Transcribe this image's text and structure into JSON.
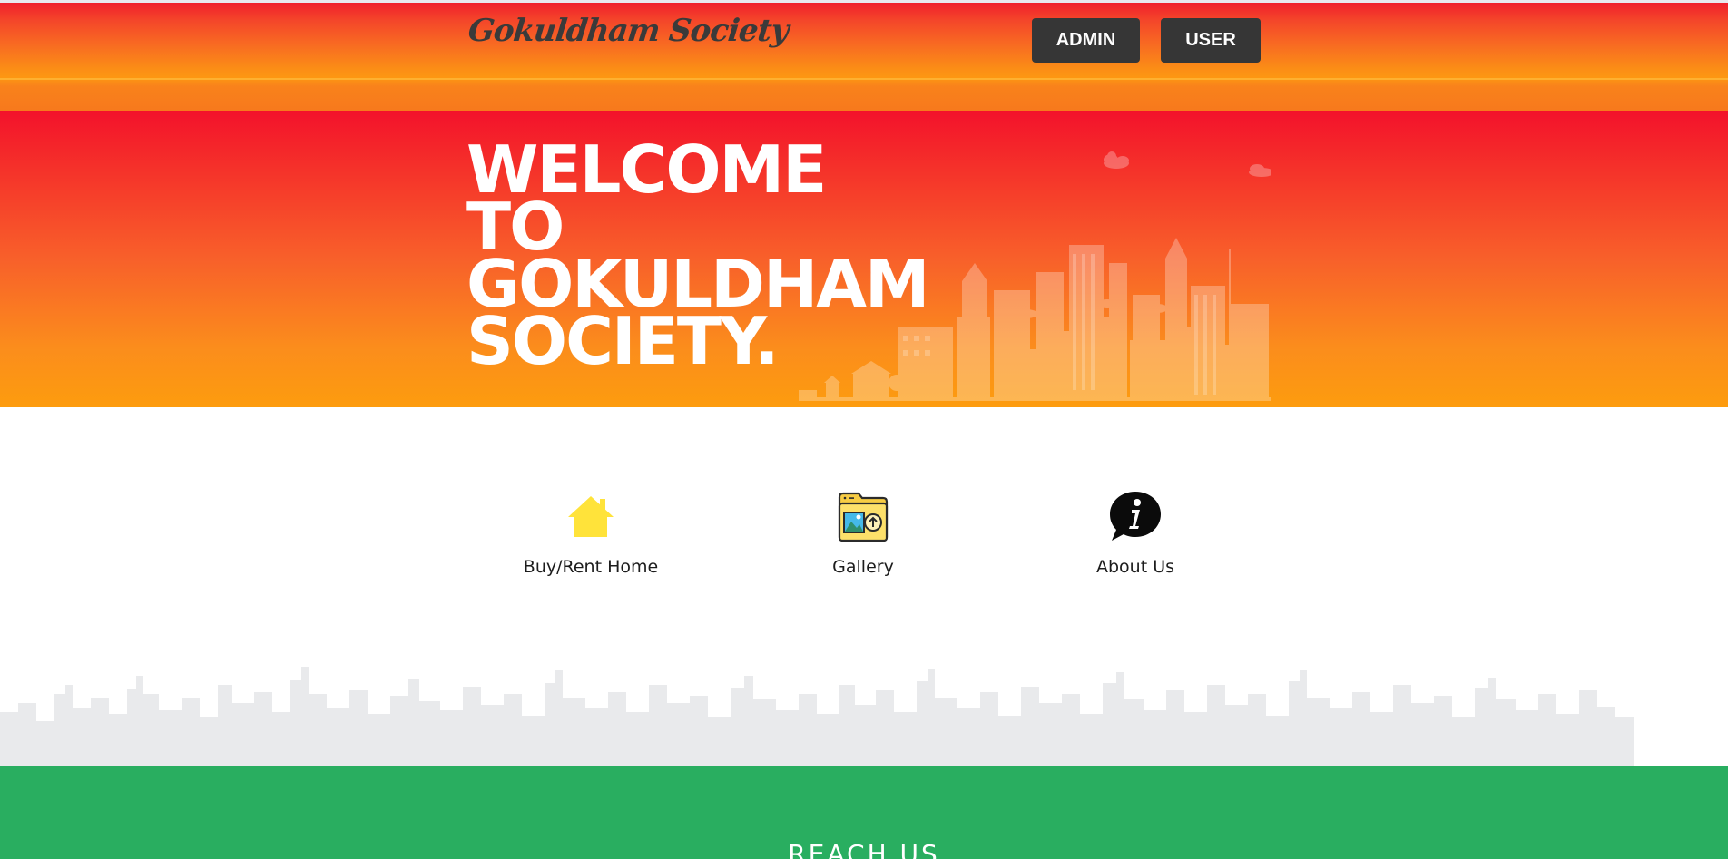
{
  "header": {
    "logo": "Gokuldham Society",
    "buttons": [
      {
        "label": "ADMIN"
      },
      {
        "label": "USER"
      }
    ]
  },
  "hero": {
    "title": "WELCOME\nTO\nGOKULDHAM\nSOCIETY.",
    "illustration": "city-skyline-illustration"
  },
  "features": [
    {
      "label": "Buy/Rent Home",
      "icon": "home-icon"
    },
    {
      "label": "Gallery",
      "icon": "gallery-folder-icon"
    },
    {
      "label": "About Us",
      "icon": "info-chat-icon"
    }
  ],
  "footer": {
    "title": "REACH US"
  },
  "colors": {
    "header_gradient_top": "#f0202c",
    "header_gradient_bottom": "#f7791c",
    "hero_gradient_top": "#f3122b",
    "hero_gradient_bottom": "#fd9c0e",
    "button_bg": "#363636",
    "footer_bg": "#29ae60",
    "home_icon": "#ffe33a"
  }
}
